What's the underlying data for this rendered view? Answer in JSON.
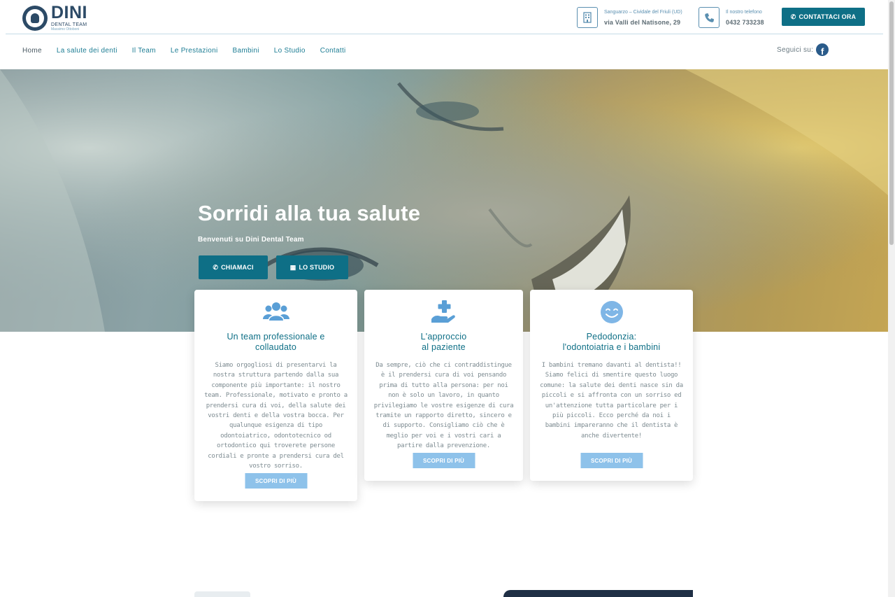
{
  "header": {
    "logo": {
      "name": "DINI",
      "line2": "DENTAL TEAM",
      "line3": "Massimo Ottoboni"
    },
    "address": {
      "label": "Sanguarzo – Cividale del Friuli (UD)",
      "value": "via Valli del Natisone, 29",
      "icon": "building-icon"
    },
    "phone": {
      "label": "Il nostro telefono",
      "value": "0432 733238",
      "icon": "phone-icon"
    },
    "cta_label": "CONTATTACI ORA",
    "cta_icon": "whatsapp-icon"
  },
  "nav": {
    "items": [
      "Home",
      "La salute dei denti",
      "Il Team",
      "Le Prestazioni",
      "Bambini",
      "Lo Studio",
      "Contatti"
    ],
    "social_label": "Seguici su:",
    "social_icon": "facebook-icon"
  },
  "hero": {
    "title": "Sorridi alla tua salute",
    "subtitle": "Benvenuti su Dini Dental Team",
    "buttons": [
      {
        "label": "CHIAMACI",
        "icon": "phone-icon"
      },
      {
        "label": "LO STUDIO",
        "icon": "building-icon"
      }
    ]
  },
  "cards": [
    {
      "icon": "users-icon",
      "title_line1": "Un team professionale e",
      "title_line2": "collaudato",
      "text": "Siamo orgogliosi di presentarvi la nostra struttura partendo dalla sua componente più importante: il nostro team. Professionale, motivato e pronto a prendersi cura di voi, della salute dei vostri denti e della vostra bocca. Per qualunque esigenza di tipo odontoiatrico, odontotecnico od ortodontico qui troverete persone cordiali e pronte a prendersi cura del vostro sorriso.",
      "button": "SCOPRI DI PIÙ"
    },
    {
      "icon": "hand-holding-medical-icon",
      "title_line1": "L'approccio",
      "title_line2": "al paziente",
      "text": "Da sempre, ciò che ci contraddistingue è il prendersi cura di voi pensando prima di tutto alla persona: per noi non è solo un lavoro, in quanto privilegiamo le vostre esigenze di cura tramite un rapporto diretto, sincero e di supporto. Consigliamo ciò che è meglio per voi e i vostri cari a partire dalla prevenzione.",
      "button": "SCOPRI DI PIÙ"
    },
    {
      "icon": "smile-icon",
      "title_line1": "Pedodonzia:",
      "title_line2": "l'odontoiatria e i bambini",
      "text": "I bambini tremano davanti al dentista!! Siamo felici di smentire questo luogo comune: la salute dei denti nasce sin da piccoli e si affronta con un sorriso ed un'attenzione tutta particolare per i più piccoli. Ecco perché da noi i bambini impareranno che il dentista è anche divertente!",
      "button": "SCOPRI DI PIÙ"
    }
  ],
  "colors": {
    "primary": "#0e6f86",
    "secondary_button": "#8ec2ea",
    "logo": "#2c4a66",
    "icon": "#5a9fd6"
  }
}
